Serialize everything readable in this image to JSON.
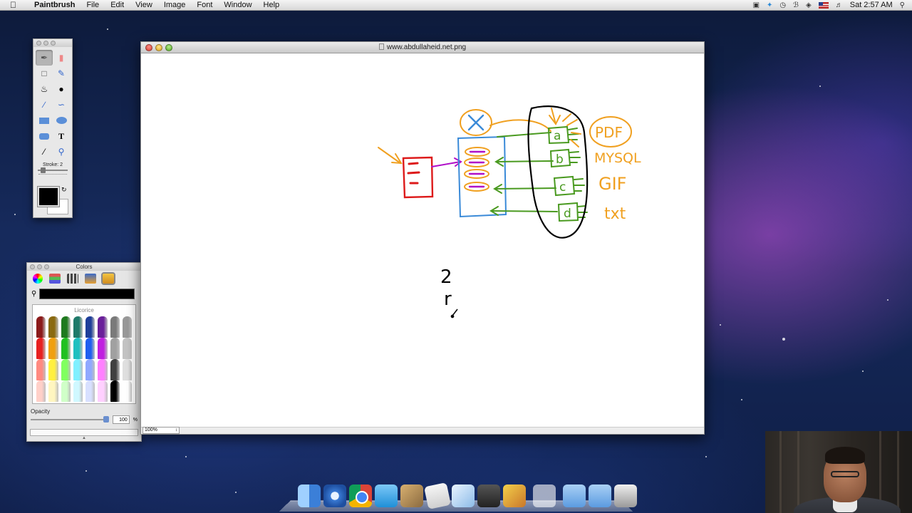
{
  "menubar": {
    "app_name": "Paintbrush",
    "menus": [
      "File",
      "Edit",
      "View",
      "Image",
      "Font",
      "Window",
      "Help"
    ],
    "clock": "Sat 2:57 AM"
  },
  "tools_palette": {
    "stroke_label": "Stroke: 2",
    "selected_tool": "brush",
    "primary_color": "#000000",
    "secondary_color": "#ffffff"
  },
  "colors_panel": {
    "title": "Colors",
    "selected_crayon": "Licorice",
    "opacity_label": "Opacity",
    "opacity_value": "100",
    "opacity_unit": "%"
  },
  "document": {
    "title": "www.abdullaheid.net.png",
    "zoom": "100%",
    "sketch_labels": [
      "PDF",
      "MYSQL",
      "GIF",
      "txt",
      "a",
      "b",
      "c",
      "d",
      "2",
      "r"
    ]
  },
  "dock": {
    "apps": [
      "Finder",
      "Safari",
      "Google Chrome",
      "Twitter",
      "Preview",
      "TextEdit",
      "Cube",
      "iMovie",
      "Paintbrush",
      "Applications",
      "Documents",
      "Trash"
    ]
  },
  "colors": {
    "orange": "#f0a020",
    "green": "#4a9a20",
    "blue": "#3a8ad8",
    "red": "#dd1a1a",
    "purple": "#b010c8",
    "black": "#000000"
  }
}
